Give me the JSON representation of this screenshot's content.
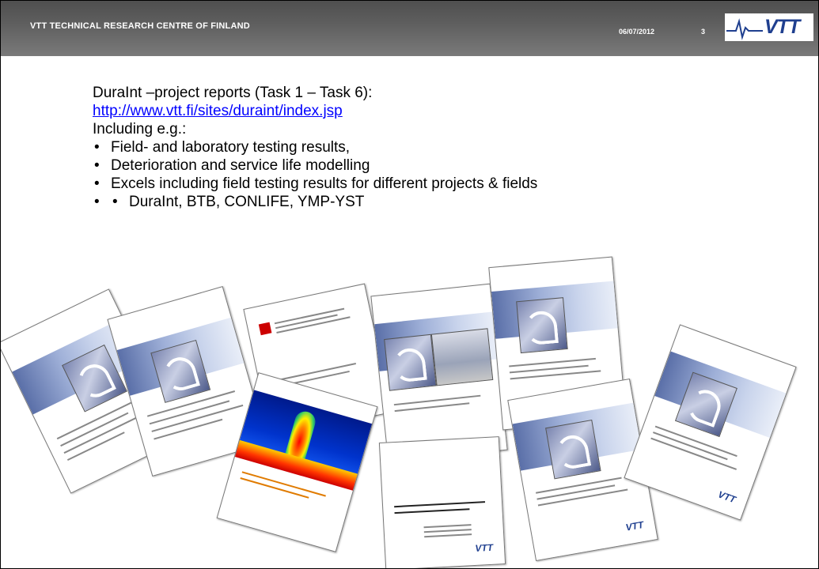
{
  "header": {
    "organization": "VTT TECHNICAL RESEARCH CENTRE OF FINLAND",
    "date": "06/07/2012",
    "page_number": "3",
    "logo_text": "VTT"
  },
  "content": {
    "intro": "DuraInt –project reports (Task 1 – Task 6):",
    "link": "http://www.vtt.fi/sites/duraint/index.jsp",
    "including": "Including e.g.:",
    "bullets": [
      "Field- and  laboratory testing results,",
      "Deterioration and service life modelling",
      "Excels including field testing results for different projects & fields"
    ],
    "sub_bullets": [
      "DuraInt, BTB, CONLIFE, YMP-YST"
    ]
  },
  "colors": {
    "header_dark": "#4f4f4f",
    "vtt_blue": "#1f3f8f",
    "link": "#0000ff"
  }
}
